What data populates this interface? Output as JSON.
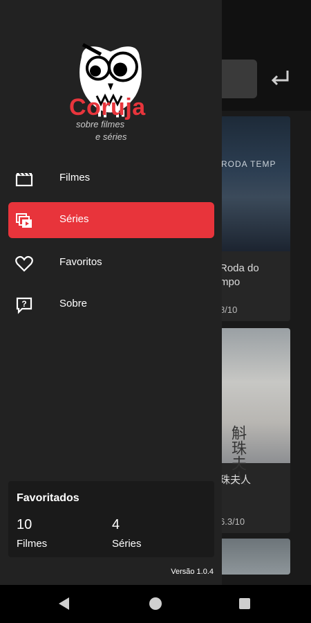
{
  "app": {
    "title": "Coruja",
    "subtitle_line1": "sobre filmes",
    "subtitle_line2": "e séries",
    "accent_color": "#e8353c"
  },
  "drawer": {
    "items": [
      {
        "label": "Filmes",
        "icon": "film-clapper-icon",
        "active": false
      },
      {
        "label": "Séries",
        "icon": "series-stack-icon",
        "active": true
      },
      {
        "label": "Favoritos",
        "icon": "heart-icon",
        "active": false
      },
      {
        "label": "Sobre",
        "icon": "help-bubble-icon",
        "active": false
      }
    ],
    "favorites": {
      "title": "Favoritados",
      "films_count": "10",
      "films_label": "Filmes",
      "series_count": "4",
      "series_label": "Séries"
    },
    "version": "Versão 1.0.4"
  },
  "background_content": {
    "cards": [
      {
        "title": "Roda do\nmpo",
        "rating": "8/10",
        "poster_text": "RODA TEMP"
      },
      {
        "title": "珠夫人",
        "rating": "6.3/10",
        "poster_text": "斛珠夫人"
      }
    ]
  },
  "navbar": {
    "buttons": [
      "back",
      "home",
      "recents"
    ]
  }
}
